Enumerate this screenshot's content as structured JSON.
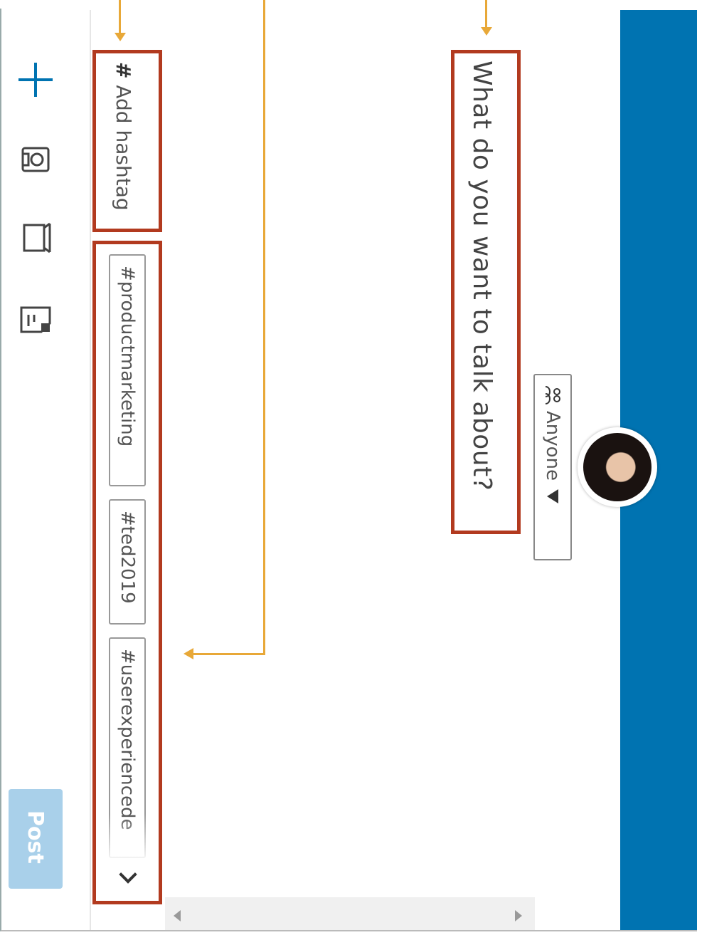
{
  "composer": {
    "prompt_placeholder": "What do you want to talk about?",
    "audience_label": "Anyone",
    "audience_icon": "people-icon",
    "close_icon": "close-icon"
  },
  "hashtags": {
    "add_label": "Add hashtag",
    "hash_symbol": "#",
    "suggestions": [
      "#productmarketing",
      "#ted2019",
      "#userexperiencede"
    ]
  },
  "toolbar": {
    "items": [
      "plus-icon",
      "camera-icon",
      "video-icon",
      "document-icon"
    ],
    "post_label": "Post"
  },
  "colors": {
    "header_blue": "#0073b1",
    "highlight_red": "#b23a1f",
    "callout_orange": "#e8a838",
    "post_disabled": "#a9d0ea"
  }
}
